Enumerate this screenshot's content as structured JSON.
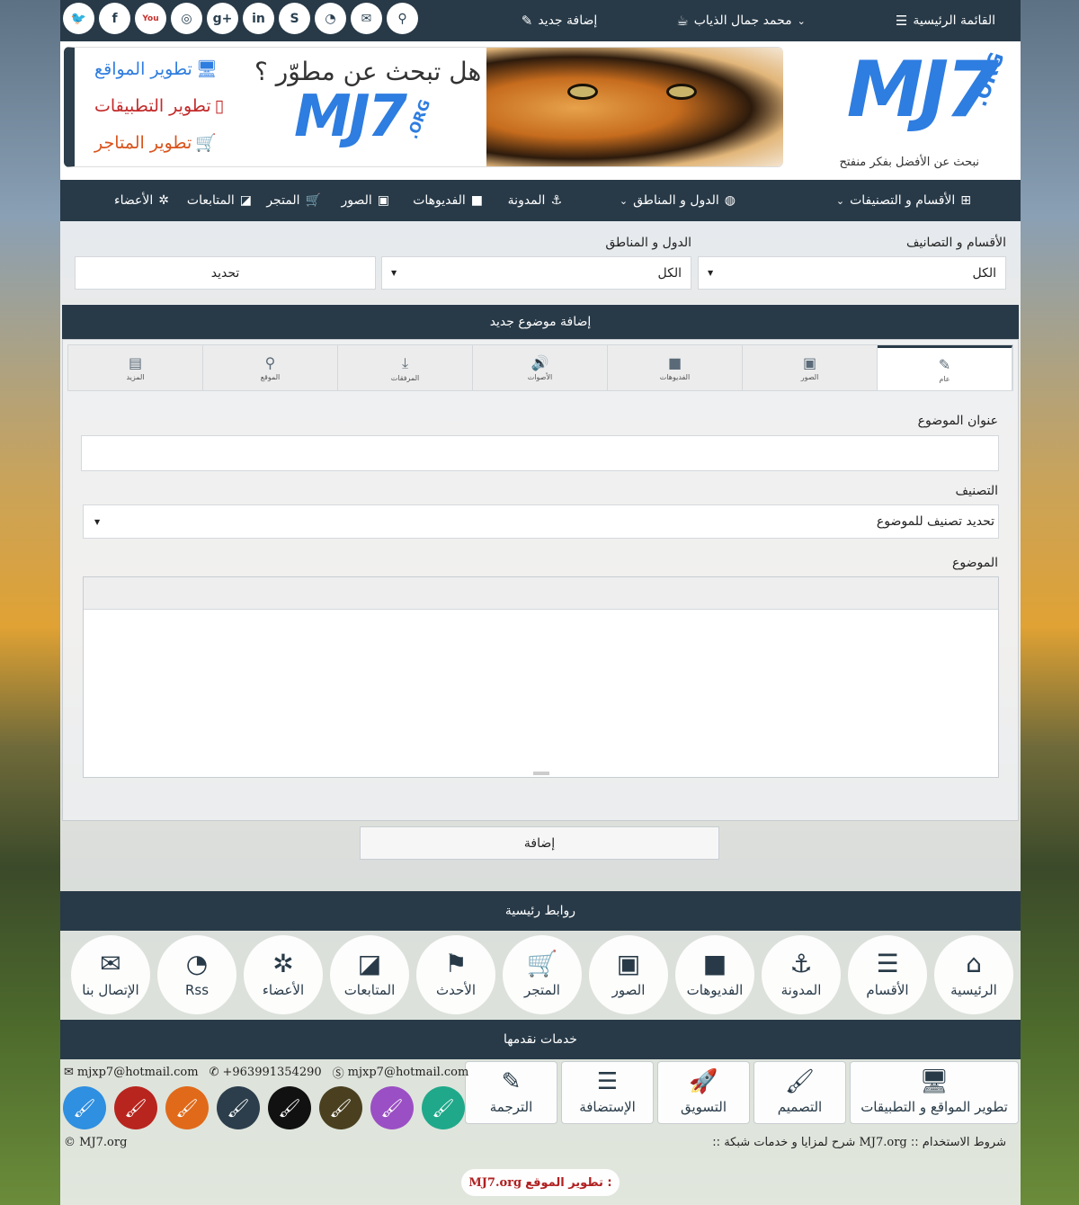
{
  "topbar": {
    "social": [
      "twitter-icon",
      "facebook-icon",
      "youtube-icon",
      "instagram-icon",
      "google-plus-icon",
      "linkedin-icon",
      "skype-icon",
      "rss-icon",
      "envelope-icon",
      "search-icon"
    ],
    "social_glyphs": [
      "🐦",
      "f",
      "You",
      "◎",
      "g+",
      "in",
      "S",
      "◔",
      "✉",
      "⚲"
    ],
    "home_label": "القائمة الرئيسية",
    "user_label": "محمد جمال الذياب",
    "add_label": "إضافة جديد"
  },
  "banner": {
    "logo": "MJ7",
    "logo_org": ".ORG",
    "tagline": "نبحث عن الأفضل بفكر منفتح",
    "ad_headline": "هل تبحث عن مطوّر ؟",
    "ad_logo": "MJ7",
    "ad_logo_org": ".ORG",
    "ad_services": [
      "تطوير المواقع",
      "تطوير التطبيقات",
      "تطوير المتاجر"
    ]
  },
  "mainnav": {
    "sections": "الأقسام و التصنيفات",
    "regions": "الدول و المناطق",
    "blog": "المدونة",
    "videos": "الفديوهات",
    "images": "الصور",
    "store": "المتجر",
    "following": "المتابعات",
    "members": "الأعضاء"
  },
  "filter": {
    "sections_label": "الأقسام و التصانيف",
    "regions_label": "الدول و المناطق",
    "sections_value": "الكل",
    "regions_value": "الكل",
    "button": "تحديد"
  },
  "form": {
    "title": "إضافة موضوع جديد",
    "tabs": [
      "عام",
      "الصور",
      "الفديوهات",
      "الأصوات",
      "المرفقات",
      "الموقع",
      "المزيد"
    ],
    "subject_label": "عنوان الموضوع",
    "category_label": "التصنيف",
    "category_value": "تحديد تصنيف للموضوع",
    "body_label": "الموضوع",
    "submit": "إضافة"
  },
  "links": {
    "title": "روابط رئيسية",
    "items": [
      "الرئيسية",
      "الأقسام",
      "المدونة",
      "الفديوهات",
      "الصور",
      "المتجر",
      "الأحدث",
      "المتابعات",
      "الأعضاء",
      "Rss",
      "الإتصال بنا"
    ]
  },
  "services": {
    "title": "خدمات نقدمها",
    "items": [
      "تطوير المواقع و التطبيقات",
      "التصميم",
      "التسويق",
      "الإستضافة",
      "الترجمة"
    ]
  },
  "contact": {
    "email1": "mjxp7@hotmail.com",
    "phone": "+963991354290",
    "email2": "mjxp7@hotmail.com"
  },
  "brush_colors": [
    "#1fa98a",
    "#9b4fc4",
    "#4a4020",
    "#111111",
    "#2c3e4c",
    "#e06a1a",
    "#b8251e",
    "#2f8fe0"
  ],
  "footer": {
    "copyright": "© MJ7.org",
    "prefix": "::",
    "about": "شرح لمزايا و خدمات شبكة",
    "site": "MJ7.org",
    "sep": "::",
    "terms": "شروط الاستخدام",
    "credit_site": "MJ7.org",
    "credit_label": "تطوير الموقع :"
  }
}
